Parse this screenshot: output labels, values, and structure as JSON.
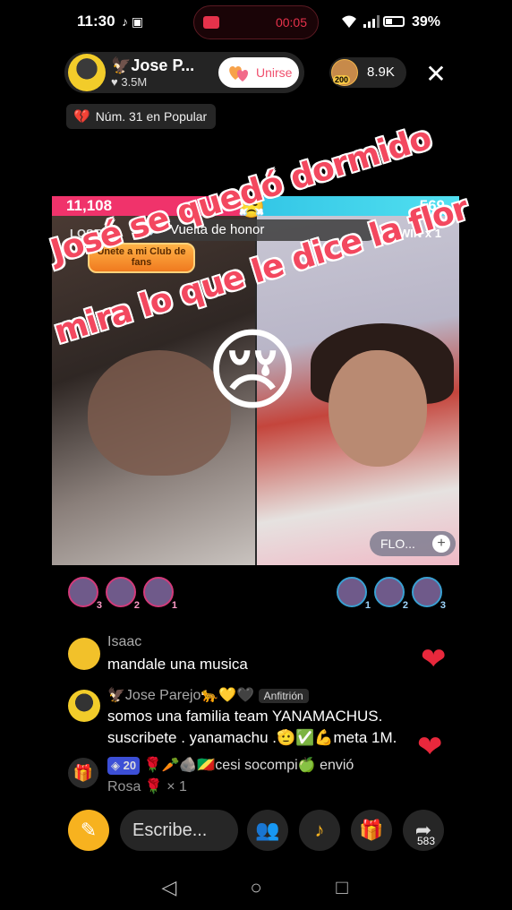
{
  "status_bar": {
    "time": "11:30",
    "record_time": "00:05",
    "battery_pct": "39%"
  },
  "host": {
    "name": "🦅Jose P...",
    "likes": "3.5M",
    "join_label": "Unirse"
  },
  "viewers": {
    "badge": "200",
    "count": "8.9K"
  },
  "ranking": {
    "label": "Núm. 31 en Popular"
  },
  "battle": {
    "score_left": "11,108",
    "score_right": "569",
    "lose_label": "LOSE",
    "win_label": "WIN",
    "win_multiplier": "x 1",
    "round_label": "Vuelta de honor",
    "union_banner": "Únete a mi Club de fans",
    "right_user": "FLO...",
    "overlay_line1": "José se quedó dormido",
    "overlay_line2": "mira lo que le dice la flor"
  },
  "supporters_left": [
    "3",
    "2",
    "1"
  ],
  "supporters_right": [
    "1",
    "2",
    "3"
  ],
  "chat": [
    {
      "name": "Isaac",
      "message": "mandale una musica"
    },
    {
      "name": "🦅Jose Parejo🐆💛🖤",
      "tag": "Anfitrión",
      "message": "somos una familia team YANAMACHUS. suscribete . yanamachu .🫡✅💪meta 1M."
    }
  ],
  "gift_event": {
    "level": "20",
    "sender": "🌹🥕🪨🇨🇬cesi socompi🍏",
    "verb": "envió",
    "gift": "Rosa",
    "count": "× 1"
  },
  "toolbar": {
    "input_placeholder": "Escribe...",
    "share_count": "583"
  },
  "colors": {
    "accent_pink": "#f0336b",
    "accent_cyan": "#33c6e6",
    "overlay_text": "#f3485f"
  },
  "icons": [
    "tiktok-icon",
    "wifi-icon",
    "signal-icon",
    "battery-icon",
    "close-icon",
    "gift-icon",
    "share-icon"
  ]
}
